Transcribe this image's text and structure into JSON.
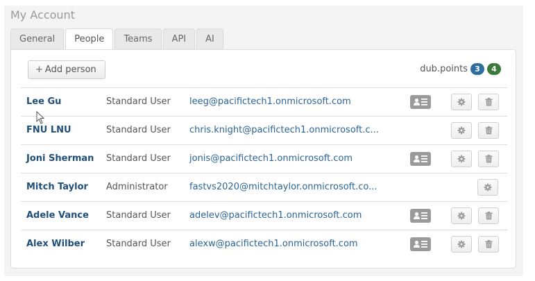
{
  "page": {
    "title": "My Account"
  },
  "tabs": [
    {
      "label": "General",
      "active": false
    },
    {
      "label": "People",
      "active": true
    },
    {
      "label": "Teams",
      "active": false
    },
    {
      "label": "API",
      "active": false
    },
    {
      "label": "AI",
      "active": false
    }
  ],
  "toolbar": {
    "add_label": "Add person"
  },
  "points": {
    "label": "dub.points",
    "badge_blue": "3",
    "badge_green": "4"
  },
  "colors": {
    "badge_blue": "#2f6f9f",
    "badge_green": "#3a7a3a",
    "link": "#2a6496",
    "name": "#1f4e79"
  },
  "icons": {
    "add": "plus-icon",
    "card": "contact-card-icon",
    "gear": "gear-icon",
    "trash": "trash-icon"
  },
  "people": [
    {
      "name": "Lee Gu",
      "role": "Standard User",
      "email": "leeg@pacifictech1.onmicrosoft.com",
      "card": true,
      "trash": true
    },
    {
      "name": "FNU LNU",
      "role": "Standard User",
      "email": "chris.knight@pacifictech1.onmicrosoft.c...",
      "card": false,
      "trash": true
    },
    {
      "name": "Joni Sherman",
      "role": "Standard User",
      "email": "jonis@pacifictech1.onmicrosoft.com",
      "card": true,
      "trash": true
    },
    {
      "name": "Mitch Taylor",
      "role": "Administrator",
      "email": "fastvs2020@mitchtaylor.onmicrosoft.co...",
      "card": false,
      "trash": false
    },
    {
      "name": "Adele Vance",
      "role": "Standard User",
      "email": "adelev@pacifictech1.onmicrosoft.com",
      "card": true,
      "trash": true
    },
    {
      "name": "Alex Wilber",
      "role": "Standard User",
      "email": "alexw@pacifictech1.onmicrosoft.com",
      "card": true,
      "trash": true
    }
  ]
}
